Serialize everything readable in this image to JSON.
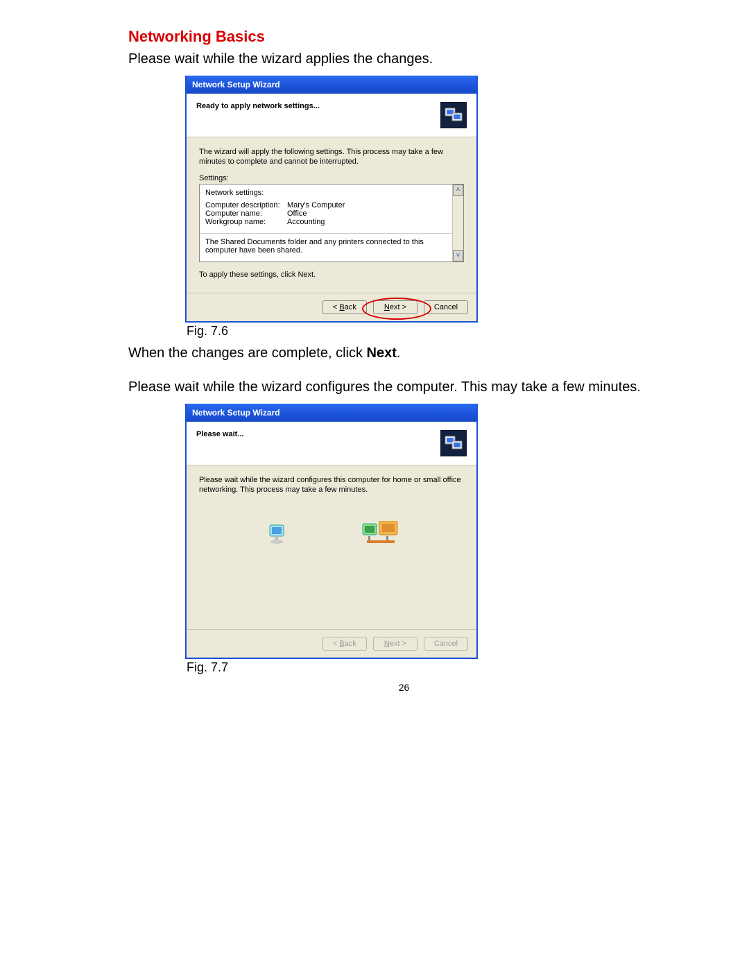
{
  "section_title": "Networking Basics",
  "para1": "Please wait while the wizard applies the changes.",
  "fig1": {
    "titlebar": "Network Setup Wizard",
    "header_title": "Ready to apply network settings...",
    "intro": "The wizard will apply the following settings. This process may take a few minutes to complete and cannot be interrupted.",
    "settings_label": "Settings:",
    "settings_heading": "Network settings:",
    "rows": [
      {
        "label": "Computer description:",
        "value": "Mary's Computer"
      },
      {
        "label": "Computer name:",
        "value": "Office"
      },
      {
        "label": "Workgroup name:",
        "value": "Accounting"
      }
    ],
    "shared_text": "The Shared Documents folder and any printers connected to this computer have been shared.",
    "apply_text": "To apply these settings, click Next.",
    "buttons": {
      "back": "< Back",
      "next": "Next >",
      "cancel": "Cancel"
    },
    "caption": "Fig. 7.6"
  },
  "para2_prefix": "When the changes are complete, click ",
  "para2_bold": "Next",
  "para2_suffix": ".",
  "para3": "Please wait while the wizard configures the computer. This may take a few minutes.",
  "fig2": {
    "titlebar": "Network Setup Wizard",
    "header_title": "Please wait...",
    "body_text": "Please wait while the wizard configures this computer for home or small office networking. This process may take a few minutes.",
    "buttons": {
      "back": "< Back",
      "next": "Next >",
      "cancel": "Cancel"
    },
    "caption": "Fig. 7.7"
  },
  "page_number": "26"
}
